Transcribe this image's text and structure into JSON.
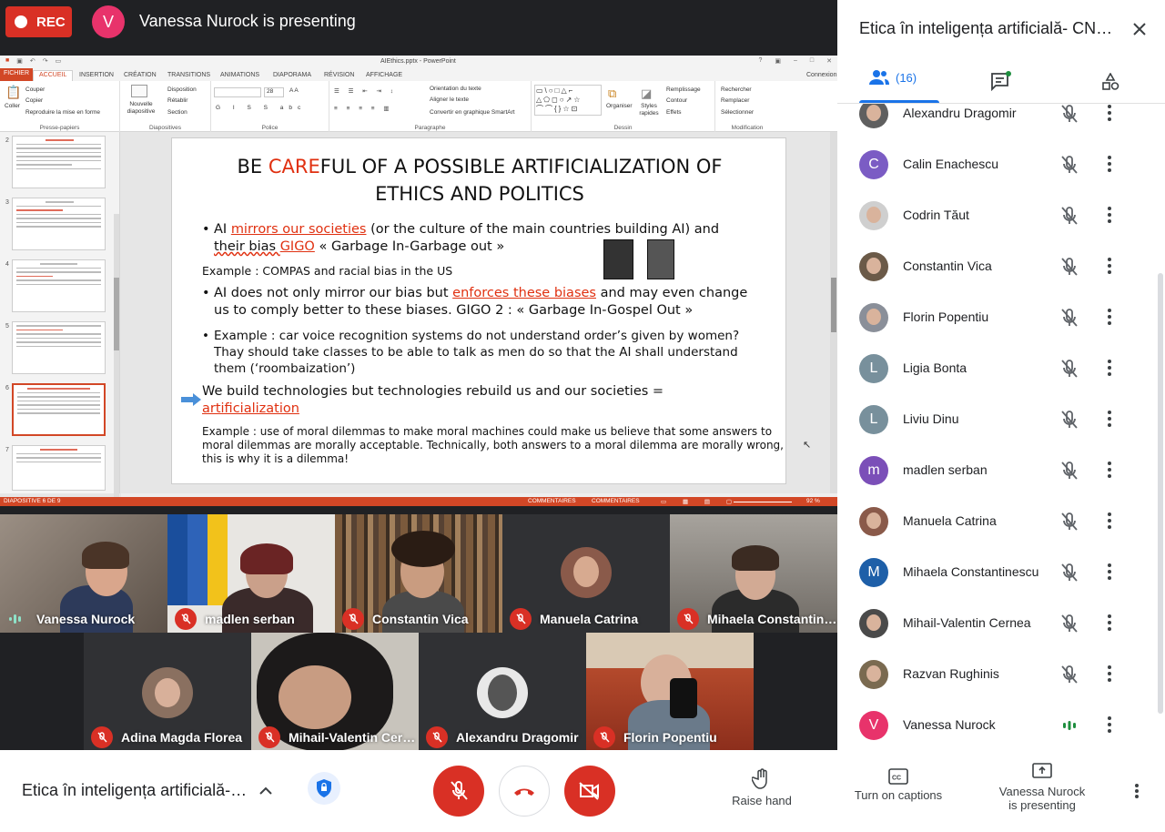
{
  "topbar": {
    "rec_label": "REC",
    "presenter_initial": "V",
    "presenting_text": "Vanessa Nurock is presenting"
  },
  "ppt": {
    "window_title": "AIEthics.pptx - PowerPoint",
    "account": "Connexion",
    "tabs": [
      "FICHIER",
      "ACCUEIL",
      "INSERTION",
      "CRÉATION",
      "TRANSITIONS",
      "ANIMATIONS",
      "DIAPORAMA",
      "RÉVISION",
      "AFFICHAGE"
    ],
    "ribbon": {
      "paste": "Coller",
      "cut": "Couper",
      "copy": "Copier",
      "format_painter": "Reproduire la mise en forme",
      "clipboard_group": "Presse-papiers",
      "new_slide": "Nouvelle diapositive",
      "layout": "Disposition",
      "reset": "Rétablir",
      "section": "Section",
      "slides_group": "Diapositives",
      "font_size": "28",
      "font_group": "Police",
      "text_direction": "Orientation du texte",
      "align_text": "Aligner le texte",
      "smartart": "Convertir en graphique SmartArt",
      "paragraph_group": "Paragraphe",
      "arrange": "Organiser",
      "quick_styles": "Styles rapides",
      "shape_fill": "Remplissage",
      "shape_outline": "Contour",
      "shape_effects": "Effets",
      "drawing_group": "Dessin",
      "find": "Rechercher",
      "replace": "Remplacer",
      "select": "Sélectionner",
      "editing_group": "Modification"
    },
    "thumb_numbers": [
      "2",
      "3",
      "4",
      "5",
      "6",
      "7"
    ],
    "slide": {
      "title_pre": "BE ",
      "title_red": "CARE",
      "title_post": "FUL OF A POSSIBLE ARTIFICIALIZATION OF",
      "title_line2": "ETHICS AND POLITICS",
      "b1_a": "AI ",
      "b1_red": "mirrors our societies",
      "b1_b": " (or the culture of the main countries building AI) and",
      "b1_line2_a": "their bias ",
      "b1_line2_red": "GIGO",
      "b1_line2_b": "  « Garbage In-Garbage out »",
      "example1": "Example : COMPAS and racial bias in the US",
      "b2_a": "AI does not only mirror our bias but ",
      "b2_red": "enforces these biases",
      "b2_b": " and may even change",
      "b2_line2": "us to comply better to these biases. GIGO 2 : « Garbage In-Gospel Out »",
      "b3_line1": "Example : car voice recognition systems do not understand order’s given by women?",
      "b3_line2": "Thay should take classes to be able to talk as men do so that the AI shall understand",
      "b3_line3": "them (‘roombaization’)",
      "b4_line1": "We build technologies but technologies rebuild us and our societies =",
      "b4_red": "artificialization",
      "ex2_line1": "Example : use of moral dilemmas to make moral machines could make us believe that some answers to",
      "ex2_line2": "moral dilemmas are morally acceptable. Technically, both answers to a moral dilemma are morally wrong,",
      "ex2_line3": "this is why it is a dilemma!"
    },
    "status": {
      "slide_counter": "DIAPOSITIVE 6 DE 9",
      "notes": "COMMENTAIRES",
      "comments": "COMMENTAIRES",
      "zoom": "92 %"
    }
  },
  "tiles": [
    {
      "name": "Vanessa Nurock",
      "speaking": true
    },
    {
      "name": "madlen serban",
      "speaking": false
    },
    {
      "name": "Constantin Vica",
      "speaking": false
    },
    {
      "name": "Manuela Catrina",
      "speaking": false
    },
    {
      "name": "Mihaela Constantin…",
      "speaking": false
    },
    {
      "name": "Adina Magda Florea",
      "speaking": false
    },
    {
      "name": "Mihail-Valentin Cer…",
      "speaking": false
    },
    {
      "name": "Alexandru Dragomir",
      "speaking": false
    },
    {
      "name": "Florin Popentiu",
      "speaking": false
    }
  ],
  "bottom": {
    "meeting_title": "Etica în inteligența artificială-…",
    "raise_hand": "Raise hand",
    "captions": "Turn on captions",
    "presenting_line1": "Vanessa Nurock",
    "presenting_line2": "is presenting"
  },
  "panel": {
    "title": "Etica în inteligența artificială- CN…",
    "people_count": "(16)",
    "participants": [
      {
        "name": "Alexandru Dragomir",
        "initial": "",
        "color": "#5f5f5f",
        "photo": true,
        "speaking": false
      },
      {
        "name": "Calin Enachescu",
        "initial": "C",
        "color": "#7b5cc4",
        "photo": false,
        "speaking": false
      },
      {
        "name": "Codrin Tăut",
        "initial": "",
        "color": "#cfcfcf",
        "photo": true,
        "speaking": false
      },
      {
        "name": "Constantin Vica",
        "initial": "",
        "color": "#6b5a48",
        "photo": true,
        "speaking": false
      },
      {
        "name": "Florin Popentiu",
        "initial": "",
        "color": "#8a8f99",
        "photo": true,
        "speaking": false
      },
      {
        "name": "Ligia Bonta",
        "initial": "L",
        "color": "#78909c",
        "photo": false,
        "speaking": false
      },
      {
        "name": "Liviu Dinu",
        "initial": "L",
        "color": "#78909c",
        "photo": false,
        "speaking": false
      },
      {
        "name": "madlen serban",
        "initial": "m",
        "color": "#7b4fb8",
        "photo": false,
        "speaking": false
      },
      {
        "name": "Manuela Catrina",
        "initial": "",
        "color": "#8a5a4a",
        "photo": true,
        "speaking": false
      },
      {
        "name": "Mihaela Constantinescu",
        "initial": "M",
        "color": "#1e5fa8",
        "photo": false,
        "speaking": false
      },
      {
        "name": "Mihail-Valentin Cernea",
        "initial": "",
        "color": "#4a4a4a",
        "photo": true,
        "speaking": false
      },
      {
        "name": "Razvan Rughinis",
        "initial": "",
        "color": "#7a6a50",
        "photo": true,
        "speaking": false
      },
      {
        "name": "Vanessa Nurock",
        "initial": "V",
        "color": "#e8336b",
        "photo": false,
        "speaking": true
      }
    ]
  },
  "colors": {
    "accent": "#1a73e8",
    "danger": "#d93025",
    "ppt_orange": "#d24726"
  }
}
